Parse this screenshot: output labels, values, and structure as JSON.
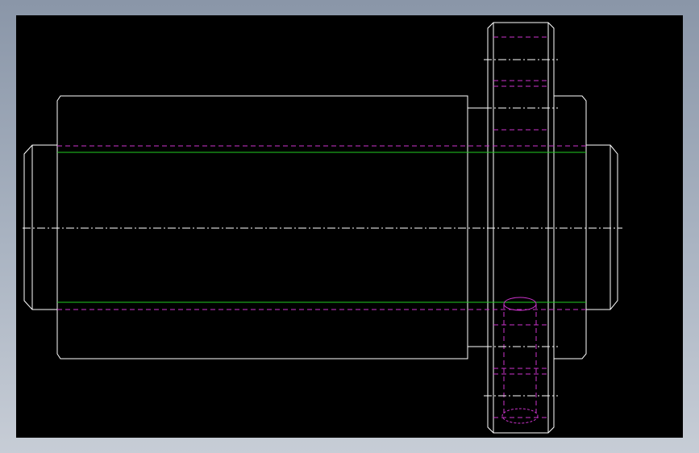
{
  "viewport": {
    "background": "#000000",
    "frame_background": "#9aa5b4"
  },
  "drawing": {
    "description_layers": {
      "outline": "#ffffff",
      "hidden": "#cc33cc",
      "bore_line": "#22cc22",
      "centerline": "#ffffff"
    }
  }
}
